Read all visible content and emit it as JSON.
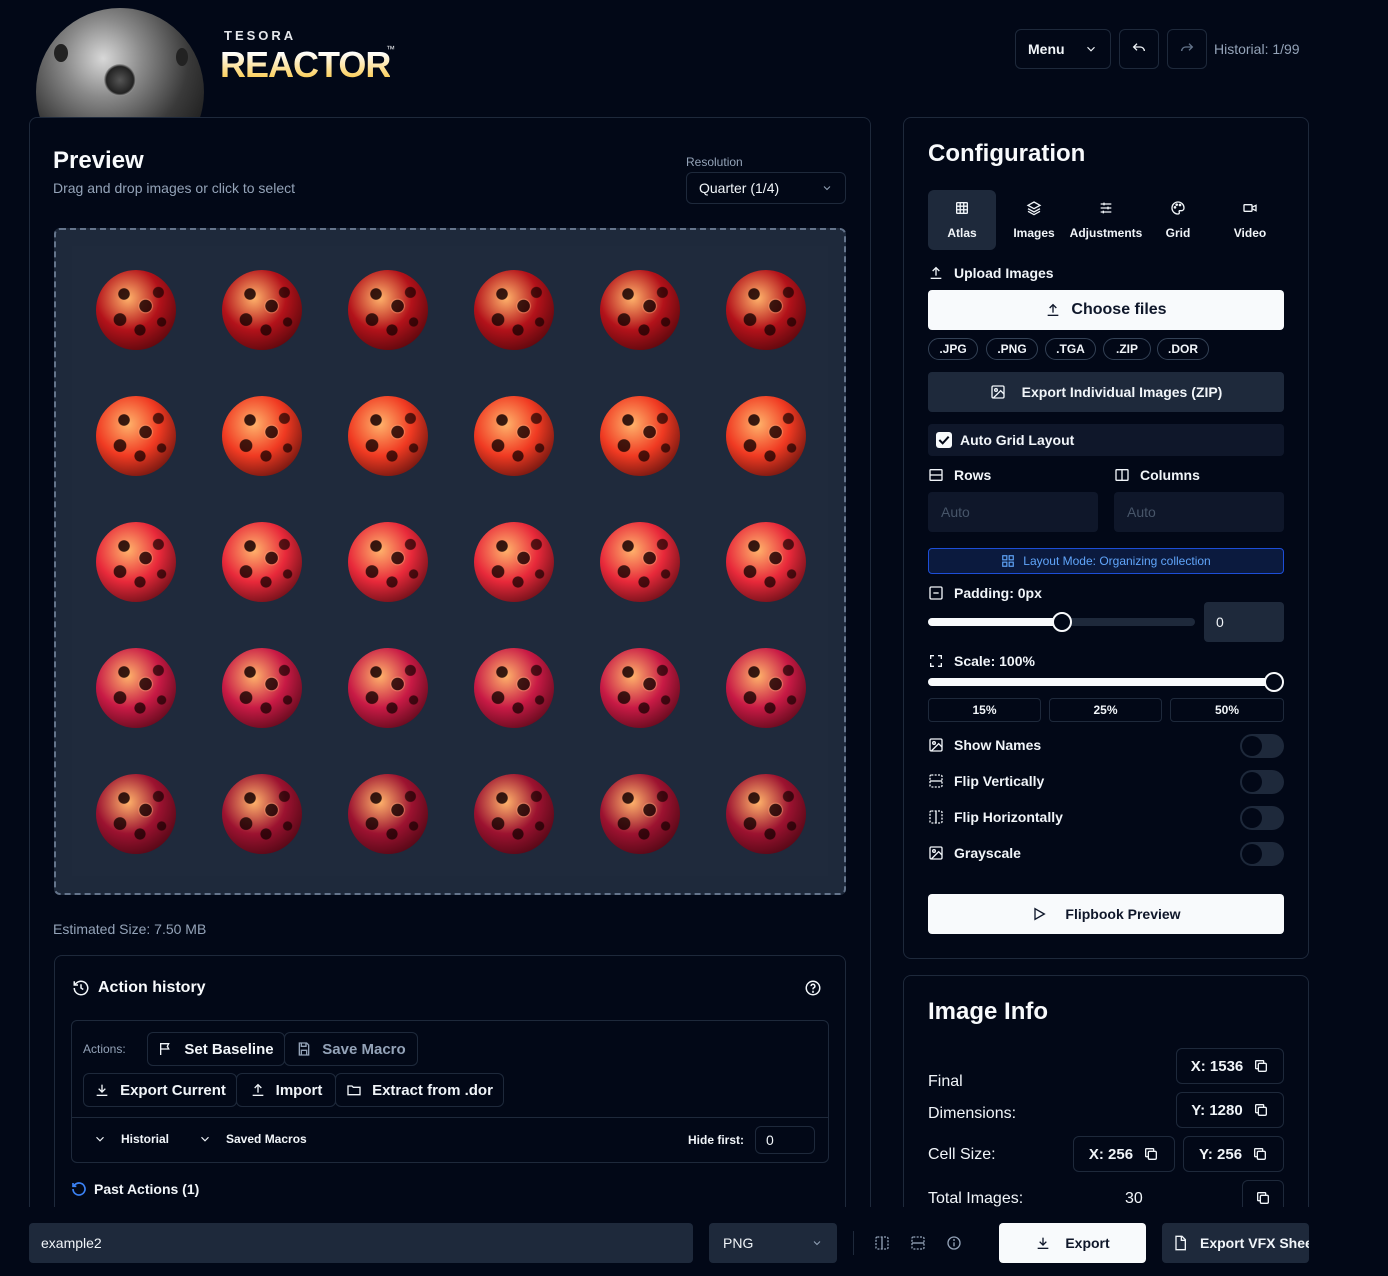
{
  "brand": {
    "top": "TESORA",
    "name": "REACTOR",
    "tm": "™"
  },
  "header": {
    "menu_label": "Menu",
    "history_label": "Historial: 1/99"
  },
  "preview": {
    "title": "Preview",
    "subtitle": "Drag and drop images or click to select",
    "resolution_label": "Resolution",
    "resolution_value": "Quarter (1/4)",
    "estimated_size": "Estimated Size: 7.50 MB",
    "grid_rows": 5,
    "grid_cols": 6,
    "row_colors": [
      "#b3121a",
      "#f03a22",
      "#e8293a",
      "#c81a45",
      "#9c1230"
    ]
  },
  "history": {
    "title": "Action history",
    "actions_label": "Actions:",
    "set_baseline": "Set Baseline",
    "save_macro": "Save Macro",
    "export_current": "Export Current",
    "import": "Import",
    "extract": "Extract from .dor",
    "historial": "Historial",
    "saved_macros": "Saved Macros",
    "hide_first_label": "Hide first:",
    "hide_first_value": "0",
    "past_actions": "Past Actions (1)"
  },
  "config": {
    "title": "Configuration",
    "tabs": [
      {
        "label": "Atlas",
        "icon": "grid-icon"
      },
      {
        "label": "Images",
        "icon": "layers-icon"
      },
      {
        "label": "Adjustments",
        "icon": "sliders-icon"
      },
      {
        "label": "Grid",
        "icon": "palette-icon"
      },
      {
        "label": "Video",
        "icon": "video-icon"
      }
    ],
    "upload_label": "Upload Images",
    "choose_files": "Choose files",
    "formats": [
      ".JPG",
      ".PNG",
      ".TGA",
      ".ZIP",
      ".DOR"
    ],
    "export_zip": "Export Individual Images (ZIP)",
    "auto_grid": "Auto Grid Layout",
    "rows_label": "Rows",
    "columns_label": "Columns",
    "rows_placeholder": "Auto",
    "columns_placeholder": "Auto",
    "layout_mode": "Layout Mode: Organizing collection",
    "padding_label": "Padding: 0px",
    "padding_value": "0",
    "padding_slider": 0.5,
    "scale_label": "Scale: 100%",
    "scale_slider": 1.0,
    "scale_presets": [
      "15%",
      "25%",
      "50%"
    ],
    "show_names": "Show Names",
    "flip_vertically": "Flip Vertically",
    "flip_horizontally": "Flip Horizontally",
    "grayscale": "Grayscale",
    "flipbook": "Flipbook Preview"
  },
  "info": {
    "title": "Image Info",
    "final_dims_label": "Final\nDimensions:",
    "final_x": "X: 1536",
    "final_y": "Y: 1280",
    "cell_size_label": "Cell Size:",
    "cell_x": "X: 256",
    "cell_y": "Y: 256",
    "total_label": "Total Images:",
    "total_value": "30"
  },
  "footer": {
    "filename": "example2",
    "format": "PNG",
    "export": "Export",
    "export_vfx": "Export VFX Sheet"
  },
  "colors": {
    "accent": "#1d4ed8",
    "panel": "#1e293b",
    "bg": "#020817",
    "brand_gold": "#fde68a"
  }
}
